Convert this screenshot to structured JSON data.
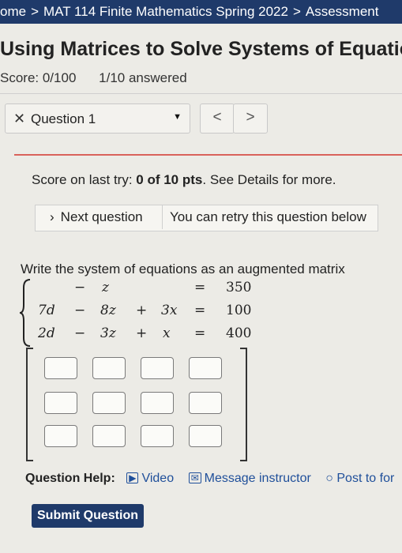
{
  "breadcrumb": {
    "items": [
      "ome",
      "MAT 114 Finite Mathematics Spring 2022",
      "Assessment"
    ],
    "separator": ">"
  },
  "page": {
    "title": "Using Matrices to Solve Systems of Equatio",
    "score_label": "Score: 0/100",
    "answered": "1/10 answered"
  },
  "question_nav": {
    "close_symbol": "✕",
    "selected": "Question 1",
    "prev": "<",
    "next": ">"
  },
  "score_last_try": {
    "prefix": "Score on last try: ",
    "score": "0 of 10 pts",
    "suffix": ". See Details for more."
  },
  "next_question": {
    "label": "Next question",
    "retry_text": "You can retry this question below"
  },
  "problem": {
    "instruction": "Write the system of equations as an augmented matrix",
    "rows": [
      {
        "c1": "",
        "op1": "−",
        "c2": "z",
        "op2": "",
        "c3": "",
        "eq": "=",
        "rhs": "350"
      },
      {
        "c1": "7d",
        "op1": "−",
        "c2": "8z",
        "op2": "+",
        "c3": "3x",
        "eq": "=",
        "rhs": "100"
      },
      {
        "c1": "2d",
        "op1": "−",
        "c2": "3z",
        "op2": "+",
        "c3": "x",
        "eq": "=",
        "rhs": "400"
      }
    ]
  },
  "matrix": {
    "rows": 3,
    "cols": 4
  },
  "help": {
    "label": "Question Help:",
    "video": "Video",
    "message": "Message instructor",
    "post": "Post to for"
  },
  "submit_label": "Submit Question",
  "colors": {
    "nav_bg": "#1f3a6a",
    "accent_red": "#d9625b",
    "link": "#1f4f9a"
  }
}
